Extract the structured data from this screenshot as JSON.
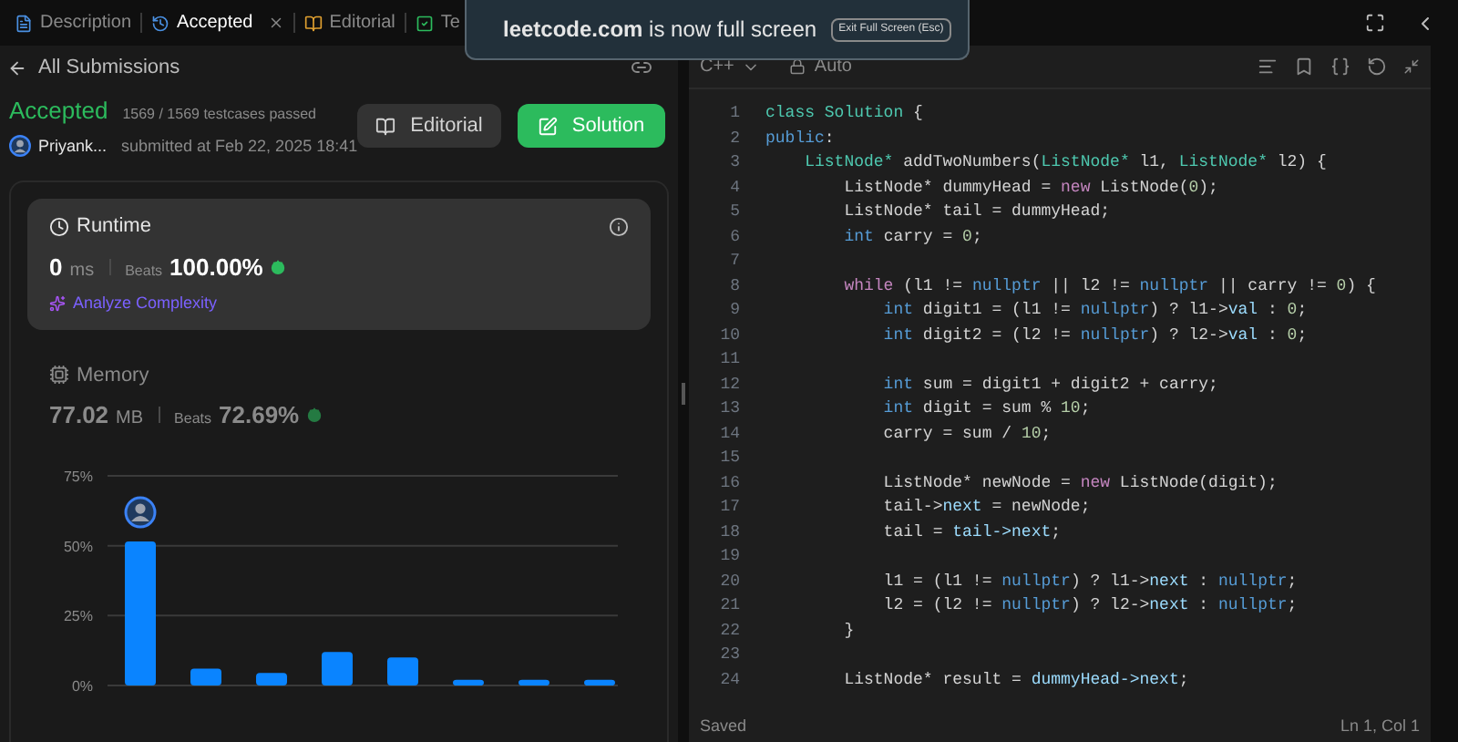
{
  "tabs": [
    {
      "label": "Description",
      "kind": "description",
      "selected": false,
      "closable": false
    },
    {
      "label": "Accepted",
      "kind": "submission",
      "selected": true,
      "closable": true
    },
    {
      "label": "Editorial",
      "kind": "editorial",
      "selected": false,
      "closable": false
    },
    {
      "label": "Te",
      "kind": "testcase",
      "selected": false,
      "closable": false
    }
  ],
  "notification": {
    "message": "**leetcode.com** is now full screen",
    "button": "Exit Full Screen (Esc)"
  },
  "submission": {
    "back_link": "All Submissions",
    "status": "Accepted",
    "testcases": "1569 / 1569 testcases passed",
    "user": "Priyank...",
    "submitted": "submitted at Feb 22, 2025 18:41",
    "buttons": [
      {
        "label": "Editorial",
        "kind": "secondary"
      },
      {
        "label": "Solution",
        "kind": "primary"
      }
    ]
  },
  "metrics": [
    {
      "title": "Runtime",
      "kind": "runtime",
      "selected": true,
      "value": "0",
      "unit": "ms",
      "beats_label": "Beats",
      "beats": "100.00%",
      "action": "Analyze Complexity"
    },
    {
      "title": "Memory",
      "kind": "memory",
      "selected": false,
      "value": "77.02",
      "unit": "MB",
      "beats_label": "Beats",
      "beats": "72.69%"
    }
  ],
  "chart_data": {
    "type": "bar",
    "ylim": [
      0,
      75
    ],
    "yticks": [
      {
        "value": 0,
        "label": "0%"
      },
      {
        "value": 25,
        "label": "25%"
      },
      {
        "value": 50,
        "label": "50%"
      },
      {
        "value": 75,
        "label": "75%"
      }
    ],
    "series": [
      {
        "color": "#0a84ff",
        "values": [
          51.5,
          6,
          4.5,
          12,
          10,
          2,
          2,
          2
        ]
      }
    ]
  },
  "editor": {
    "language": "C++",
    "mode": "Auto",
    "status": "Saved",
    "cursor": "Ln 1, Col 1",
    "lines": [
      {
        "number": "1",
        "tokens": [
          {
            "kind": "type",
            "text": "class Solution"
          },
          {
            "kind": "plain",
            "text": " {"
          }
        ]
      },
      {
        "number": "2",
        "tokens": [
          {
            "kind": "keyword",
            "text": "public"
          },
          {
            "kind": "plain",
            "text": ":"
          }
        ]
      },
      {
        "number": "3",
        "tokens": [
          {
            "kind": "type",
            "text": "    ListNode*"
          },
          {
            "kind": "plain",
            "text": " addTwoNumbers("
          },
          {
            "kind": "type",
            "text": "ListNode*"
          },
          {
            "kind": "plain",
            "text": " l1, "
          },
          {
            "kind": "type",
            "text": "ListNode*"
          },
          {
            "kind": "plain",
            "text": " l2) {"
          }
        ]
      },
      {
        "number": "4",
        "tokens": [
          {
            "kind": "plain",
            "text": "        ListNode* dummyHead = "
          },
          {
            "kind": "control",
            "text": "new"
          },
          {
            "kind": "plain",
            "text": " ListNode("
          },
          {
            "kind": "number",
            "text": "0"
          },
          {
            "kind": "plain",
            "text": ");"
          }
        ]
      },
      {
        "number": "5",
        "tokens": [
          {
            "kind": "plain",
            "text": "        ListNode* tail = dummyHead;"
          }
        ]
      },
      {
        "number": "6",
        "tokens": [
          {
            "kind": "keyword",
            "text": "        int"
          },
          {
            "kind": "plain",
            "text": " carry = "
          },
          {
            "kind": "number",
            "text": "0"
          },
          {
            "kind": "plain",
            "text": ";"
          }
        ]
      },
      {
        "number": "7"
      },
      {
        "number": "8",
        "tokens": [
          {
            "kind": "control",
            "text": "        while"
          },
          {
            "kind": "plain",
            "text": " (l1 != "
          },
          {
            "kind": "keyword",
            "text": "nullptr"
          },
          {
            "kind": "plain",
            "text": " || l2 != "
          },
          {
            "kind": "keyword",
            "text": "nullptr"
          },
          {
            "kind": "plain",
            "text": " || carry != "
          },
          {
            "kind": "number",
            "text": "0"
          },
          {
            "kind": "plain",
            "text": ") {"
          }
        ]
      },
      {
        "number": "9",
        "tokens": [
          {
            "kind": "keyword",
            "text": "            int"
          },
          {
            "kind": "plain",
            "text": " digit1 = (l1 != "
          },
          {
            "kind": "keyword",
            "text": "nullptr"
          },
          {
            "kind": "plain",
            "text": ") ? l1->"
          },
          {
            "kind": "member",
            "text": "val"
          },
          {
            "kind": "plain",
            "text": " : "
          },
          {
            "kind": "number",
            "text": "0"
          },
          {
            "kind": "plain",
            "text": ";"
          }
        ]
      },
      {
        "number": "10",
        "tokens": [
          {
            "kind": "keyword",
            "text": "            int"
          },
          {
            "kind": "plain",
            "text": " digit2 = (l2 != "
          },
          {
            "kind": "keyword",
            "text": "nullptr"
          },
          {
            "kind": "plain",
            "text": ") ? l2->"
          },
          {
            "kind": "member",
            "text": "val"
          },
          {
            "kind": "plain",
            "text": " : "
          },
          {
            "kind": "number",
            "text": "0"
          },
          {
            "kind": "plain",
            "text": ";"
          }
        ]
      },
      {
        "number": "11"
      },
      {
        "number": "12",
        "tokens": [
          {
            "kind": "keyword",
            "text": "            int"
          },
          {
            "kind": "plain",
            "text": " sum = digit1 + digit2 + carry;"
          }
        ]
      },
      {
        "number": "13",
        "tokens": [
          {
            "kind": "keyword",
            "text": "            int"
          },
          {
            "kind": "plain",
            "text": " digit = sum % "
          },
          {
            "kind": "number",
            "text": "10"
          },
          {
            "kind": "plain",
            "text": ";"
          }
        ]
      },
      {
        "number": "14",
        "tokens": [
          {
            "kind": "plain",
            "text": "            carry = sum / "
          },
          {
            "kind": "number",
            "text": "10"
          },
          {
            "kind": "plain",
            "text": ";"
          }
        ]
      },
      {
        "number": "15"
      },
      {
        "number": "16",
        "tokens": [
          {
            "kind": "plain",
            "text": "            ListNode* newNode = "
          },
          {
            "kind": "control",
            "text": "new"
          },
          {
            "kind": "plain",
            "text": " ListNode(digit);"
          }
        ]
      },
      {
        "number": "17",
        "tokens": [
          {
            "kind": "plain",
            "text": "            tail->"
          },
          {
            "kind": "member",
            "text": "next"
          },
          {
            "kind": "plain",
            "text": " = newNode;"
          }
        ]
      },
      {
        "number": "18",
        "tokens": [
          {
            "kind": "plain",
            "text": "            tail = "
          },
          {
            "kind": "member",
            "text": "tail->next"
          },
          {
            "kind": "plain",
            "text": ";"
          }
        ]
      },
      {
        "number": "19"
      },
      {
        "number": "20",
        "tokens": [
          {
            "kind": "plain",
            "text": "            l1 = (l1 != "
          },
          {
            "kind": "keyword",
            "text": "nullptr"
          },
          {
            "kind": "plain",
            "text": ") ? l1->"
          },
          {
            "kind": "member",
            "text": "next"
          },
          {
            "kind": "plain",
            "text": " : "
          },
          {
            "kind": "keyword",
            "text": "nullptr"
          },
          {
            "kind": "plain",
            "text": ";"
          }
        ]
      },
      {
        "number": "21",
        "tokens": [
          {
            "kind": "plain",
            "text": "            l2 = (l2 != "
          },
          {
            "kind": "keyword",
            "text": "nullptr"
          },
          {
            "kind": "plain",
            "text": ") ? l2->"
          },
          {
            "kind": "member",
            "text": "next"
          },
          {
            "kind": "plain",
            "text": " : "
          },
          {
            "kind": "keyword",
            "text": "nullptr"
          },
          {
            "kind": "plain",
            "text": ";"
          }
        ]
      },
      {
        "number": "22",
        "tokens": [
          {
            "kind": "plain",
            "text": "        }"
          }
        ]
      },
      {
        "number": "23"
      },
      {
        "number": "24",
        "tokens": [
          {
            "kind": "plain",
            "text": "        ListNode* result = "
          },
          {
            "kind": "member",
            "text": "dummyHead->next"
          },
          {
            "kind": "plain",
            "text": ";"
          }
        ]
      }
    ]
  }
}
